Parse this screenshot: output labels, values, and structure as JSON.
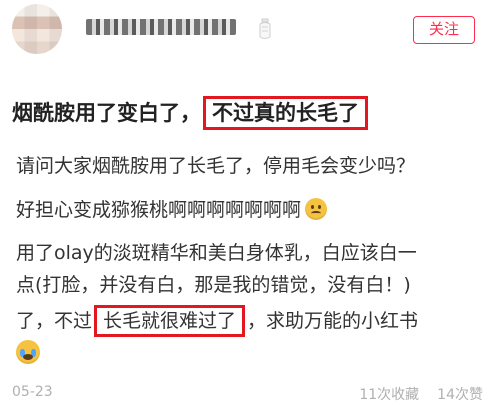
{
  "header": {
    "follow_label": "关注",
    "icon_name": "bottle-icon"
  },
  "post": {
    "title_part_1": "烟酰胺用了变白了，",
    "title_part_2": "不过真的长毛了",
    "line_1": "请问大家烟酰胺用了长毛了，停用毛会变少吗？",
    "line_2": "好担心变成猕猴桃啊啊啊啊啊啊啊",
    "line_3": "用了olay的淡斑精华和美白身体乳，白应该白一",
    "line_4": "点(打脸，并没有白，那是我的错觉，没有白！)",
    "line_5_prefix": "了，不过",
    "line_5_highlight": "长毛就很难过了",
    "line_5_suffix": "，求助万能的小红书",
    "emojis": [
      "worried-face-emoji",
      "crying-face-emoji"
    ]
  },
  "footer": {
    "date": "05-23",
    "saves": "11次收藏",
    "likes": "14次赞"
  },
  "colors": {
    "accent_red": "#e2171f",
    "follow_red": "#ff2c4d",
    "muted_gray": "#b0b0b0"
  }
}
